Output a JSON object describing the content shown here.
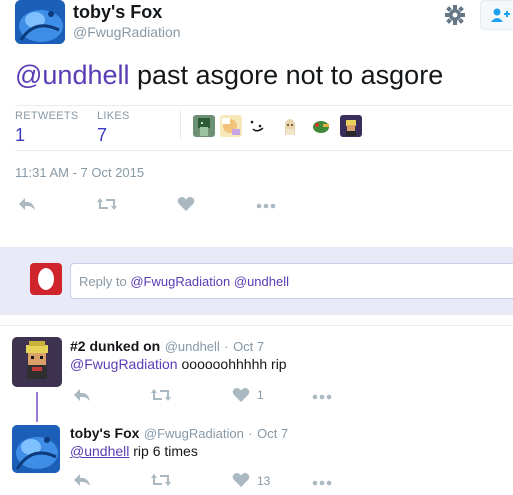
{
  "tweet": {
    "display_name": "toby's Fox",
    "screen_name": "@FwugRadiation",
    "mention": "@undhell",
    "text_rest": " past asgore not to asgore",
    "stats": {
      "retweets_label": "RETWEETS",
      "retweets_value": "1",
      "likes_label": "LIKES",
      "likes_value": "7"
    },
    "liker_avatar_count": 6,
    "timestamp": "11:31 AM - 7 Oct 2015"
  },
  "reply_box": {
    "prefix": "Reply to ",
    "mention1": "@FwugRadiation",
    "mention2": "@undhell"
  },
  "replies": [
    {
      "display_name": "#2 dunked on",
      "screen_name": "@undhell",
      "date": "Oct 7",
      "mention": "@FwugRadiation",
      "text": " oooooohhhhh rip",
      "like_count": "1"
    },
    {
      "display_name": "toby's Fox",
      "screen_name": "@FwugRadiation",
      "date": "Oct 7",
      "mention": "@undhell",
      "text": " rip 6 times",
      "like_count": "13"
    }
  ],
  "colors": {
    "mention": "#5a3cb5",
    "stat_value": "#3b3bc4",
    "muted": "#8899a6",
    "reply_band": "#e8eaf7"
  }
}
